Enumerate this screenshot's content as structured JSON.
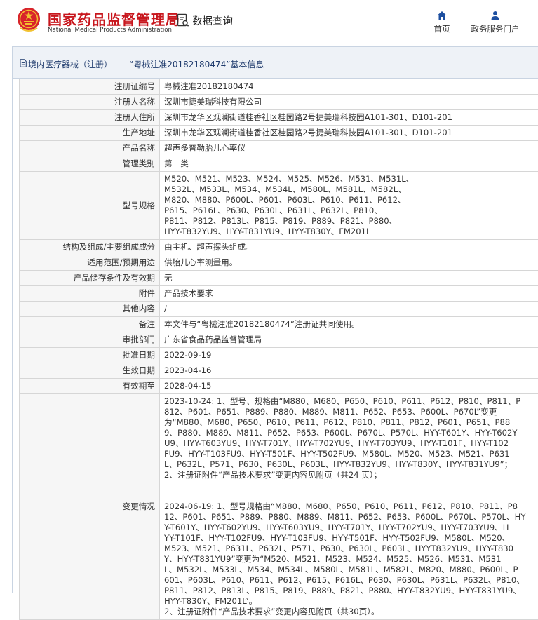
{
  "header": {
    "brand_cn": "国家药品监督管理局",
    "brand_en": "National Medical Products Administration",
    "query_label": "数据查询",
    "nav": [
      {
        "label": "首页",
        "icon": "home-icon"
      },
      {
        "label": "政务服务门户",
        "icon": "user-icon"
      }
    ],
    "colors": {
      "brand_red": "#c8161d",
      "panel_border": "#c9d4e2",
      "panel_head_bg": "#eef2f7",
      "label_bg": "#f6f6f6"
    }
  },
  "panel": {
    "title": "境内医疗器械（注册）——“粤械注准20182180474”基本信息"
  },
  "rows": [
    {
      "label": "注册证编号",
      "value": "粤械注准20182180474"
    },
    {
      "label": "注册人名称",
      "value": "深圳市捷美瑞科技有限公司"
    },
    {
      "label": "注册人住所",
      "value": "深圳市龙华区观澜街道桂香社区桂园路2号捷美瑞科技园A101-301、D101-201"
    },
    {
      "label": "生产地址",
      "value": "深圳市龙华区观澜街道桂香社区桂园路2号捷美瑞科技园A101-301、D101-201"
    },
    {
      "label": "产品名称",
      "value": "超声多普勒胎儿心率仪"
    },
    {
      "label": "管理类别",
      "value": "第二类"
    },
    {
      "label": "型号规格",
      "lines": [
        "M520、M521、M523、M524、M525、M526、M531、M531L、",
        "M532L、M533L、M534、M534L、M580L、M581L、M582L、",
        "M820、M880、P600L、P601、P603L、P610、P611、P612、",
        "P615、P616L、P630、P630L、P631L、P632L、P810、",
        "P811、P812、P813L、P815、P819、P889、P821、P880、",
        "HYY-T832YU9、HYY-T831YU9、HYY-T830Y、FM201L"
      ]
    },
    {
      "label": "结构及组成/主要组成成分",
      "value": "由主机、超声探头组成。"
    },
    {
      "label": "适用范围/预期用途",
      "value": "供胎儿心率测量用。"
    },
    {
      "label": "产品储存条件及有效期",
      "value": "无"
    },
    {
      "label": "附件",
      "value": "产品技术要求"
    },
    {
      "label": "其他内容",
      "value": "/"
    },
    {
      "label": "备注",
      "value": "本文件与“粤械注准20182180474”注册证共同使用。"
    },
    {
      "label": "审批部门",
      "value": "广东省食品药品监督管理局"
    },
    {
      "label": "批准日期",
      "value": "2022-09-19"
    },
    {
      "label": "生效日期",
      "value": "2023-04-16"
    },
    {
      "label": "有效期至",
      "value": "2028-04-15"
    }
  ],
  "changes": {
    "label": "变更情况",
    "block1": [
      "2023-10-24: 1、型号、规格由“M880、M680、P650、P610、P611、P612、P810、P811、P",
      "812、P601、P651、P889、P880、M889、M811、P652、P653、P600L、P670L”变更",
      "为“M880、M680、P650、P610、P611、P612、P810、P811、P812、P601、P651、P88",
      "9、P880、M889、M811、P652、P653、P600L、P670L、P570L、HYY-T601Y、HYY-T602Y",
      "U9、HYY-T603YU9、HYY-T701Y、HYY-T702YU9、HYY-T703YU9、HYY-T101F、HYY-T102",
      "FU9、HYY-T103FU9、HYY-T501F、HYY-T502FU9、M580L、M520、M523、M521、P631",
      "L、P632L、P571、P630、P630L、P603L、HYY-T832YU9、HYY-T830Y、HYY-T831YU9”；",
      "2、注册证附件“产品技术要求”变更内容见附页（共24 页）；"
    ],
    "block2": [
      "2024-06-19: 1、型号规格由“M880、M680、P650、P610、P611、P612、P810、P811、P8",
      "12、P601、P651、P889、P880、M889、M811、P652、P653、P600L、P670L、P570L、HY",
      "Y-T601Y、HYY-T602YU9、HYY-T603YU9、HYY-T701Y、HYY-T702YU9、HYY-T703YU9、H",
      "YY-T101F、HYY-T102FU9、HYY-T103FU9、HYY-T501F、HYY-T502FU9、M580L、M520、",
      "M523、M521、P631L、P632L、P571、P630、P630L、P603L、HYYT832YU9、HYY-T830",
      "Y、HYY-T831YU9”变更为“M520、M521、M523、M524、M525、M526、M531、M531",
      "L、M532L、M533L、M534、M534L、M580L、M581L、M582L、M820、M880、P600L、P",
      "601、P603L、P610、P611、P612、P615、P616L、P630、P630L、P631L、P632L、P810、",
      "P811、P812、P813L、P815、P819、P889、P821、P880、HYY-T832YU9、HYY-T831YU9、",
      "HYY-T830Y、FM201L”。",
      "2、注册证附件“产品技术要求”变更内容见附页（共30页）。"
    ]
  }
}
